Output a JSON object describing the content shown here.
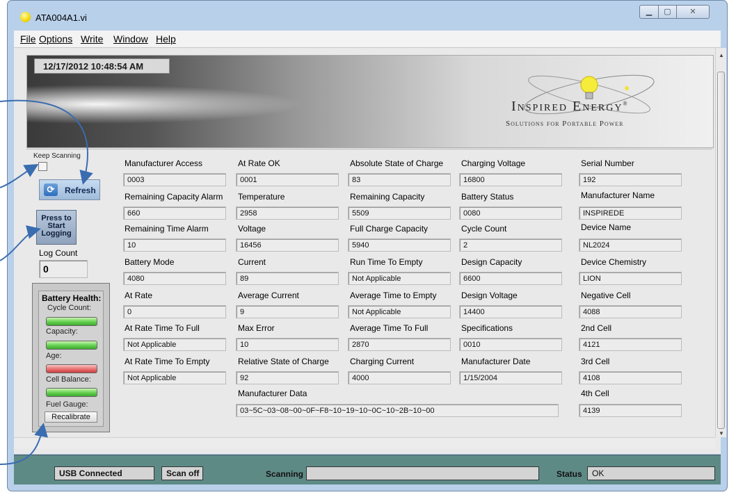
{
  "window": {
    "title": "ATA004A1.vi"
  },
  "menu": [
    "File",
    "Options",
    "Write",
    "Window",
    "Help"
  ],
  "banner": {
    "datetime": "12/17/2012 10:48:54 AM",
    "logo_main": "Inspired Energy",
    "logo_reg": "®",
    "logo_sub": "Solutions for Portable Power"
  },
  "controls": {
    "keep_scanning_label": "Keep Scanning",
    "refresh_label": "Refresh",
    "logging_line1": "Press to",
    "logging_line2": "Start",
    "logging_line3": "Logging",
    "log_count_label": "Log Count",
    "log_count_value": "0"
  },
  "health": {
    "title": "Battery Health:",
    "cycle_count": "Cycle Count:",
    "capacity": "Capacity:",
    "age": "Age:",
    "cell_balance": "Cell Balance:",
    "fuel_gauge": "Fuel Gauge:",
    "recalibrate": "Recalibrate",
    "statuses": {
      "cycle_count": "ok",
      "capacity": "ok",
      "age": "bad",
      "cell_balance": "ok"
    }
  },
  "fields": {
    "manufacturer_access": {
      "label": "Manufacturer Access",
      "value": "0003"
    },
    "remaining_capacity_alarm": {
      "label": "Remaining Capacity Alarm",
      "value": "660"
    },
    "remaining_time_alarm": {
      "label": "Remaining Time Alarm",
      "value": "10"
    },
    "battery_mode": {
      "label": "Battery Mode",
      "value": "4080"
    },
    "at_rate": {
      "label": "At Rate",
      "value": "0"
    },
    "at_rate_time_to_full": {
      "label": "At Rate Time To Full",
      "value": "Not Applicable"
    },
    "at_rate_time_to_empty": {
      "label": "At Rate Time To Empty",
      "value": "Not Applicable"
    },
    "at_rate_ok": {
      "label": "At Rate OK",
      "value": "0001"
    },
    "temperature": {
      "label": "Temperature",
      "value": "2958"
    },
    "voltage": {
      "label": "Voltage",
      "value": "16456"
    },
    "current": {
      "label": "Current",
      "value": "89"
    },
    "average_current": {
      "label": "Average Current",
      "value": "9"
    },
    "max_error": {
      "label": "Max Error",
      "value": "10"
    },
    "relative_state_of_charge": {
      "label": "Relative State of Charge",
      "value": "92"
    },
    "absolute_state_of_charge": {
      "label": "Absolute State of Charge",
      "value": "83"
    },
    "remaining_capacity": {
      "label": "Remaining Capacity",
      "value": "5509"
    },
    "full_charge_capacity": {
      "label": "Full Charge Capacity",
      "value": "5940"
    },
    "run_time_to_empty": {
      "label": "Run Time To Empty",
      "value": "Not Applicable"
    },
    "average_time_to_empty": {
      "label": "Average Time to Empty",
      "value": "Not Applicable"
    },
    "average_time_to_full": {
      "label": "Average Time To Full",
      "value": "2870"
    },
    "charging_current": {
      "label": "Charging Current",
      "value": "4000"
    },
    "charging_voltage": {
      "label": "Charging Voltage",
      "value": "16800"
    },
    "battery_status": {
      "label": "Battery Status",
      "value": "0080"
    },
    "cycle_count": {
      "label": "Cycle Count",
      "value": "2"
    },
    "design_capacity": {
      "label": "Design Capacity",
      "value": "6600"
    },
    "design_voltage": {
      "label": "Design Voltage",
      "value": "14400"
    },
    "specifications": {
      "label": "Specifications",
      "value": "0010"
    },
    "manufacturer_date": {
      "label": "Manufacturer Date",
      "value": "1/15/2004"
    },
    "serial_number": {
      "label": "Serial Number",
      "value": "192"
    },
    "manufacturer_name": {
      "label": "Manufacturer Name",
      "value": "INSPIREDE"
    },
    "device_name": {
      "label": "Device Name",
      "value": "NL2024"
    },
    "device_chemistry": {
      "label": "Device Chemistry",
      "value": "LION"
    },
    "negative_cell": {
      "label": "Negative Cell",
      "value": "4088"
    },
    "cell_2nd": {
      "label": "2nd Cell",
      "value": "4121"
    },
    "cell_3rd": {
      "label": "3rd Cell",
      "value": "4108"
    },
    "cell_4th": {
      "label": "4th Cell",
      "value": "4139"
    },
    "manufacturer_data": {
      "label": "Manufacturer Data",
      "value": "03~5C~03~08~00~0F~F8~10~19~10~0C~10~2B~10~00"
    }
  },
  "statusbar": {
    "usb": "USB Connected",
    "scan": "Scan off",
    "scanning_label": "Scanning",
    "scanning_value": "",
    "status_label": "Status",
    "status_value": "OK"
  },
  "colors": {
    "accent": "#5e8a86",
    "health_ok": "#62d04e",
    "health_bad": "#e87070",
    "annotation_arrow": "#3a6cb0"
  }
}
